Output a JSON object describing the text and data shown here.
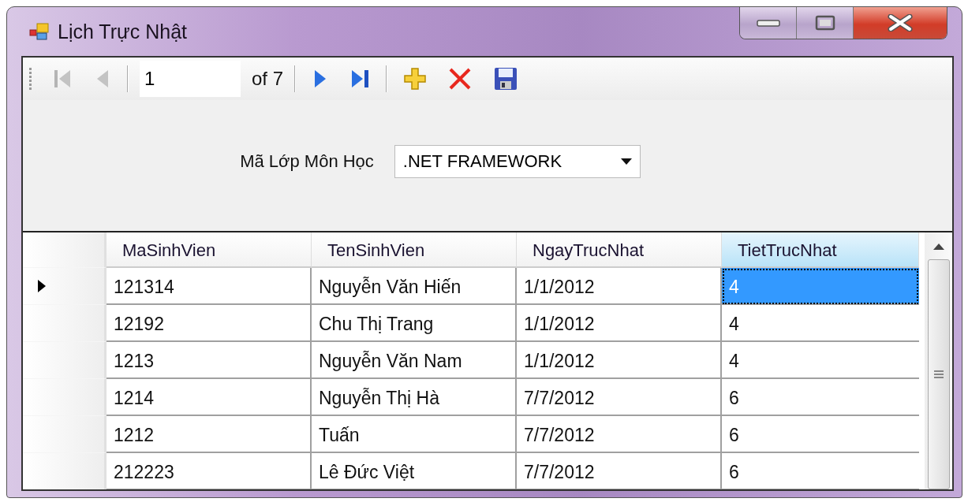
{
  "window": {
    "title": "Lịch Trực Nhật"
  },
  "toolbar": [
    {
      "kind": "first",
      "disabled": true
    },
    {
      "kind": "prev",
      "disabled": true
    },
    {
      "kind": "separator"
    },
    {
      "kind": "position",
      "value": "1"
    },
    {
      "kind": "count",
      "text": "of 7"
    },
    {
      "kind": "separator"
    },
    {
      "kind": "next",
      "disabled": false
    },
    {
      "kind": "last",
      "disabled": false
    },
    {
      "kind": "separator"
    },
    {
      "kind": "add",
      "disabled": false
    },
    {
      "kind": "delete",
      "disabled": false
    },
    {
      "kind": "save",
      "disabled": false
    }
  ],
  "filter": {
    "label": "Mã Lớp Môn Học",
    "value": ".NET FRAMEWORK"
  },
  "table": {
    "columns": [
      {
        "label": "MaSinhVien",
        "selected": false
      },
      {
        "label": "TenSinhVien",
        "selected": false
      },
      {
        "label": "NgayTrucNhat",
        "selected": false
      },
      {
        "label": "TietTrucNhat",
        "selected": true
      }
    ],
    "rows": [
      {
        "current": true,
        "cells": [
          {
            "text": "121314",
            "selected": false
          },
          {
            "text": "Nguyễn Văn Hiến",
            "selected": false
          },
          {
            "text": "1/1/2012",
            "selected": false
          },
          {
            "text": "4",
            "selected": true
          }
        ]
      },
      {
        "current": false,
        "cells": [
          {
            "text": "12192",
            "selected": false
          },
          {
            "text": "Chu Thị Trang",
            "selected": false
          },
          {
            "text": "1/1/2012",
            "selected": false
          },
          {
            "text": "4",
            "selected": false
          }
        ]
      },
      {
        "current": false,
        "cells": [
          {
            "text": "1213",
            "selected": false
          },
          {
            "text": "Nguyễn Văn Nam",
            "selected": false
          },
          {
            "text": "1/1/2012",
            "selected": false
          },
          {
            "text": "4",
            "selected": false
          }
        ]
      },
      {
        "current": false,
        "cells": [
          {
            "text": "1214",
            "selected": false
          },
          {
            "text": "Nguyễn Thị Hà",
            "selected": false
          },
          {
            "text": "7/7/2012",
            "selected": false
          },
          {
            "text": "6",
            "selected": false
          }
        ]
      },
      {
        "current": false,
        "cells": [
          {
            "text": "1212",
            "selected": false
          },
          {
            "text": "Tuấn",
            "selected": false
          },
          {
            "text": "7/7/2012",
            "selected": false
          },
          {
            "text": "6",
            "selected": false
          }
        ]
      },
      {
        "current": false,
        "cells": [
          {
            "text": "212223",
            "selected": false
          },
          {
            "text": "Lê Đức Việt",
            "selected": false
          },
          {
            "text": "7/7/2012",
            "selected": false
          },
          {
            "text": "6",
            "selected": false
          }
        ]
      }
    ]
  }
}
